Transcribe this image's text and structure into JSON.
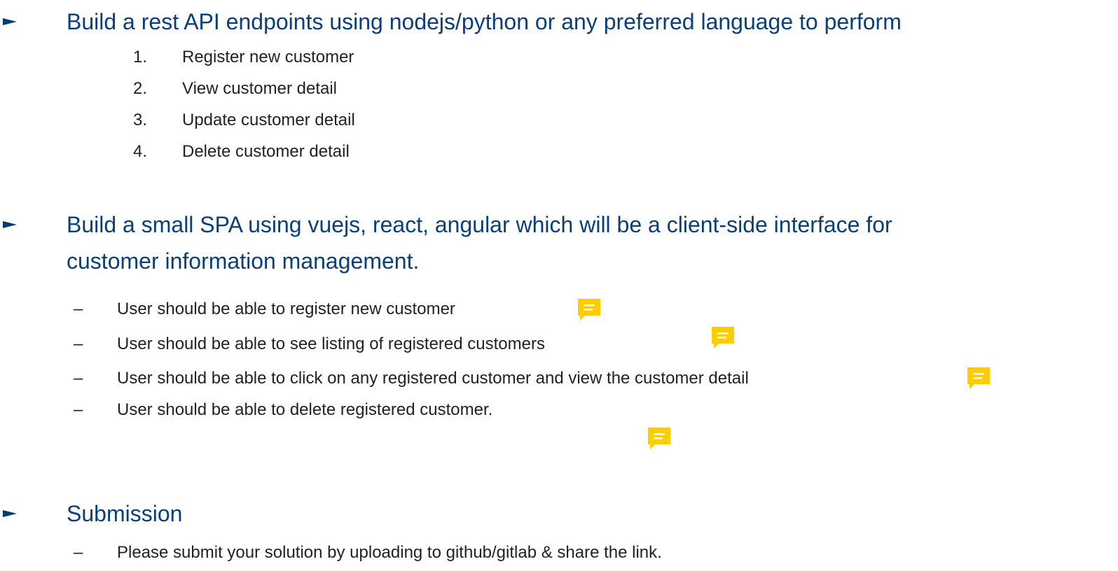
{
  "sections": [
    {
      "heading": "Build a rest API endpoints using nodejs/python or any preferred language to perform",
      "items": [
        {
          "marker": "1.",
          "text": "Register new customer"
        },
        {
          "marker": "2.",
          "text": "View customer detail"
        },
        {
          "marker": "3.",
          "text": "Update customer detail"
        },
        {
          "marker": "4.",
          "text": "Delete customer detail"
        }
      ]
    },
    {
      "heading_line1": "Build a small SPA using vuejs, react, angular which will be a client-side interface for",
      "heading_line2": "customer information management.",
      "items": [
        {
          "marker": "–",
          "text": "User should be able to register new customer"
        },
        {
          "marker": "–",
          "text": "User should be able to see listing of registered customers"
        },
        {
          "marker": "–",
          "text": "User should be able to click on any registered customer and view the customer detail"
        },
        {
          "marker": "–",
          "text": "User should be able to delete registered customer."
        }
      ]
    },
    {
      "heading": "Submission",
      "items": [
        {
          "marker": "–",
          "text": "Please submit your solution by uploading to github/gitlab & share the link."
        }
      ]
    }
  ],
  "colors": {
    "heading": "#0b3f7a",
    "bullet_arrow": "#003b73",
    "body_text": "#222222",
    "comment_icon": "#ffcc00"
  },
  "icons": {
    "bullet": "arrow-bullet-icon",
    "comment": "comment-note-icon"
  }
}
